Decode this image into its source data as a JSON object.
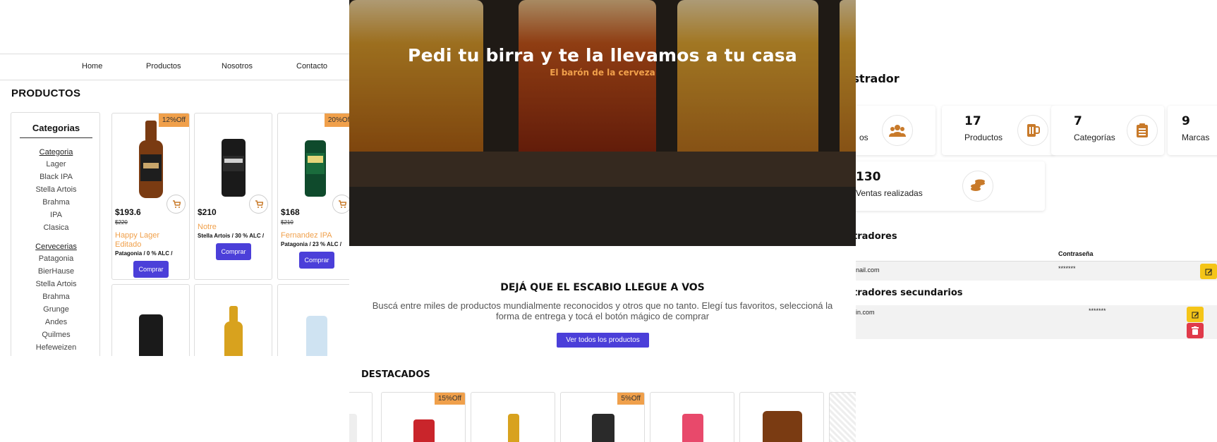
{
  "products_page": {
    "nav": [
      "Home",
      "Productos",
      "Nosotros",
      "Contacto"
    ],
    "title": "PRODUCTOS",
    "sidebar": {
      "title": "Categorias",
      "group1": "Categoria",
      "categories": [
        "Lager",
        "Black IPA",
        "Stella Artois",
        "Brahma",
        "IPA",
        "Clasica"
      ],
      "group2": "Cervecerias",
      "breweries": [
        "Patagonia",
        "BierHause",
        "Stella Artois",
        "Brahma",
        "Grunge",
        "Andes",
        "Quilmes",
        "Hefeweizen"
      ]
    },
    "products": [
      {
        "badge": "12%Off",
        "price": "$193.6",
        "old_price": "$220",
        "name": "Happy Lager Editado",
        "meta": "Patagonia / 0 % ALC /",
        "buy": "Comprar",
        "colors": {
          "body": "#7a3b12",
          "label": "#1e1e1e",
          "accent": "#c9a66b"
        }
      },
      {
        "badge": "",
        "price": "$210",
        "old_price": "",
        "name": "Notre",
        "meta": "Stella Artois / 30 % ALC /",
        "buy": "Comprar",
        "colors": {
          "body": "#1a1a1a",
          "label": "#2b2b2b",
          "accent": "#d0d0d0"
        }
      },
      {
        "badge": "20%Off",
        "price": "$168",
        "old_price": "$210",
        "name": "Fernandez IPA",
        "meta": "Patagonia / 23 % ALC /",
        "buy": "Comprar",
        "colors": {
          "body": "#0f4a2c",
          "label": "#1a6b3c",
          "accent": "#e6d67a"
        }
      }
    ],
    "row2_colors": [
      "#1a1a1a",
      "#d8a21e",
      "#cfe3f2"
    ]
  },
  "home_page": {
    "hero_title": "Pedi tu birra y te la llevamos a tu casa",
    "hero_subtitle": "El barón de la cerveza",
    "section_title": "DEJÁ QUE EL ESCABIO LLEGUE A VOS",
    "section_text": "Buscá entre miles de productos mundialmente reconocidos y otros que no tanto. Elegí tus favoritos, seleccioná la forma de entrega y tocá el botón mágico de comprar",
    "cta": "Ver todos los productos",
    "featured_title": "DESTACADOS",
    "featured": [
      {
        "badge": "",
        "color": "#eeeeee"
      },
      {
        "badge": "15%Off",
        "color": "#c9252b"
      },
      {
        "badge": "",
        "color": "#d8a21e"
      },
      {
        "badge": "5%Off",
        "color": "#2a2a2a"
      },
      {
        "badge": "",
        "color": "#e8496b"
      },
      {
        "badge": "",
        "color": "#7a3b12"
      }
    ]
  },
  "admin": {
    "title": "istrador",
    "stats": [
      {
        "num": "",
        "label": "os",
        "icon": "users-icon"
      },
      {
        "num": "17",
        "label": "Productos",
        "icon": "beer-mug-icon"
      },
      {
        "num": "7",
        "label": "Categorías",
        "icon": "clipboard-icon"
      },
      {
        "num": "9",
        "label": "Marcas",
        "icon": ""
      },
      {
        "num": "130",
        "label": "Ventas realizadas",
        "icon": "coins-icon"
      }
    ],
    "admins_title": "tradores",
    "col_password": "Contraseña",
    "admin_row": {
      "email": "nail.com",
      "password": "*******"
    },
    "secondary_title": "tradores secundarios",
    "secondary_row": {
      "email": "in.com",
      "password": "*******"
    },
    "colors": {
      "edit": "#f5c518",
      "delete": "#e03a4a",
      "icon": "#c87a2a"
    }
  }
}
